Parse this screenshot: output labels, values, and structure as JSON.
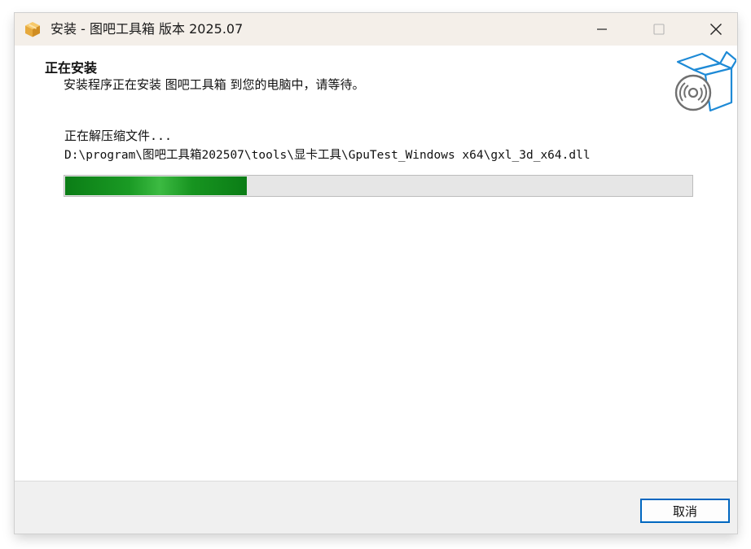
{
  "window": {
    "title": "安装 - 图吧工具箱 版本 2025.07",
    "app_icon": "package-box-icon",
    "controls": {
      "minimize": "minimize-icon",
      "maximize": "maximize-icon",
      "close": "close-icon"
    }
  },
  "header": {
    "title": "正在安装",
    "subtitle": "安装程序正在安装 图吧工具箱 到您的电脑中，请等待。",
    "image": "open-box-with-disc-icon"
  },
  "progress": {
    "status": "正在解压缩文件...",
    "current_file": "D:\\program\\图吧工具箱202507\\tools\\显卡工具\\GpuTest_Windows x64\\gxl_3d_x64.dll",
    "fraction": 0.29
  },
  "footer": {
    "cancel_label": "取消"
  },
  "colors": {
    "titlebar_bg": "#f4efe9",
    "progress_fill": "#0b7d16",
    "progress_track": "#e6e6e6",
    "button_focus_border": "#0067c0"
  }
}
